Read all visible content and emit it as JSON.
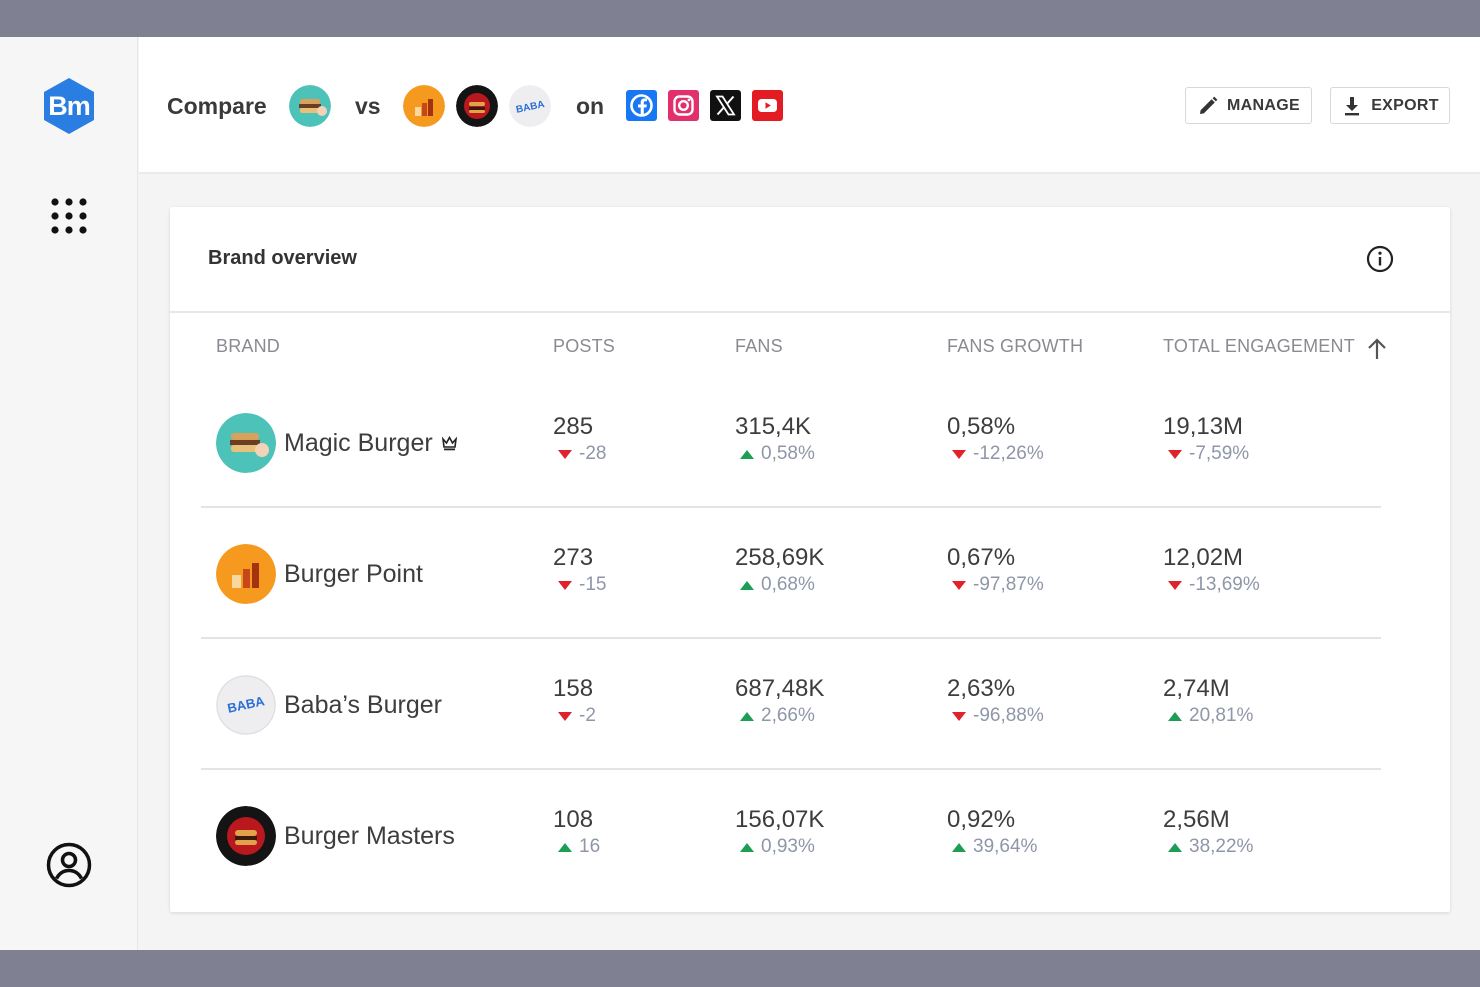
{
  "sidebar": {
    "logo_text": "Bm",
    "apps_icon": "apps-grid-icon",
    "user_icon": "user-account-icon"
  },
  "header": {
    "compare_label": "Compare",
    "vs_label": "vs",
    "on_label": "on",
    "main_brand": "Magic Burger",
    "competitors": [
      "Burger Point",
      "Burger Masters",
      "Baba's Burger"
    ],
    "networks": [
      "facebook-icon",
      "instagram-icon",
      "x-icon",
      "youtube-icon"
    ],
    "manage_label": "MANAGE",
    "export_label": "EXPORT"
  },
  "overview": {
    "title": "Brand overview",
    "columns": {
      "brand": "BRAND",
      "posts": "POSTS",
      "fans": "FANS",
      "fans_growth": "FANS GROWTH",
      "total_engagement": "TOTAL ENGAGEMENT"
    },
    "rows": [
      {
        "brand": "Magic Burger",
        "posts": "285",
        "posts_delta": "-28",
        "posts_dir": "down",
        "fans": "315,4K",
        "fans_delta": "0,58%",
        "fans_dir": "up",
        "growth": "0,58%",
        "growth_delta": "-12,26%",
        "growth_dir": "down",
        "engagement": "19,13M",
        "engagement_delta": "-7,59%",
        "engagement_dir": "down"
      },
      {
        "brand": "Burger Point",
        "posts": "273",
        "posts_delta": "-15",
        "posts_dir": "down",
        "fans": "258,69K",
        "fans_delta": "0,68%",
        "fans_dir": "up",
        "growth": "0,67%",
        "growth_delta": "-97,87%",
        "growth_dir": "down",
        "engagement": "12,02M",
        "engagement_delta": "-13,69%",
        "engagement_dir": "down"
      },
      {
        "brand": "Baba’s Burger",
        "posts": "158",
        "posts_delta": "-2",
        "posts_dir": "down",
        "fans": "687,48K",
        "fans_delta": "2,66%",
        "fans_dir": "up",
        "growth": "2,63%",
        "growth_delta": "-96,88%",
        "growth_dir": "down",
        "engagement": "2,74M",
        "engagement_delta": "20,81%",
        "engagement_dir": "up"
      },
      {
        "brand": "Burger Masters",
        "posts": "108",
        "posts_delta": "16",
        "posts_dir": "up",
        "fans": "156,07K",
        "fans_delta": "0,93%",
        "fans_dir": "up",
        "growth": "0,92%",
        "growth_delta": "39,64%",
        "growth_dir": "up",
        "engagement": "2,56M",
        "engagement_delta": "38,22%",
        "engagement_dir": "up"
      }
    ]
  },
  "colors": {
    "accent_blue": "#2a7de1",
    "delta_up": "#1e9e54",
    "delta_down": "#e0222d"
  }
}
